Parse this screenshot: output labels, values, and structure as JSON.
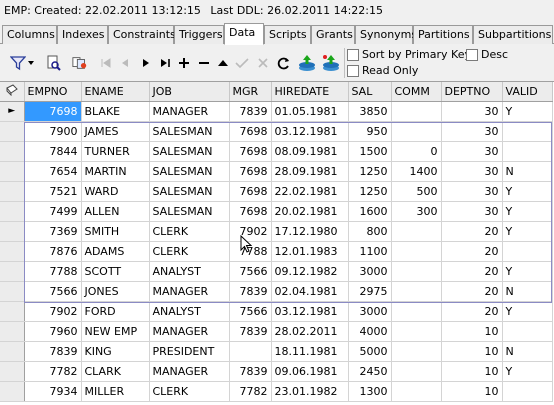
{
  "header": {
    "table_name": "EMP:",
    "created_label": "Created:",
    "created_value": "22.02.2011 13:12:15",
    "ddl_label": "Last DDL:",
    "ddl_value": "26.02.2011 14:22:15"
  },
  "tabs": [
    {
      "label": "Columns"
    },
    {
      "label": "Indexes"
    },
    {
      "label": "Constraints"
    },
    {
      "label": "Triggers"
    },
    {
      "label": "Data"
    },
    {
      "label": "Scripts"
    },
    {
      "label": "Grants"
    },
    {
      "label": "Synonyms"
    },
    {
      "label": "Partitions"
    },
    {
      "label": "Subpartitions"
    }
  ],
  "active_tab": "Data",
  "toolbar": {
    "sort_by_pk_label": "Sort by Primary Key",
    "desc_label": "Desc",
    "read_only_label": "Read Only",
    "icons": [
      "filter-icon",
      "filter-dropdown-icon",
      "find-icon",
      "refresh-icon",
      "first-record-icon",
      "prior-record-icon",
      "next-record-icon",
      "last-record-icon",
      "insert-record-icon",
      "delete-record-icon",
      "edit-record-icon",
      "post-edit-icon",
      "cancel-edit-icon",
      "refresh-data-icon",
      "commit-icon",
      "rollback-icon"
    ]
  },
  "grid": {
    "columns": [
      "EMPNO",
      "ENAME",
      "JOB",
      "MGR",
      "HIREDATE",
      "SAL",
      "COMM",
      "DEPTNO",
      "VALID"
    ],
    "rows": [
      [
        "7698",
        "BLAKE",
        "MANAGER",
        "7839",
        "01.05.1981",
        "3850",
        "",
        "30",
        "Y"
      ],
      [
        "7900",
        "JAMES",
        "SALESMAN",
        "7698",
        "03.12.1981",
        "950",
        "",
        "30",
        ""
      ],
      [
        "7844",
        "TURNER",
        "SALESMAN",
        "7698",
        "08.09.1981",
        "1500",
        "0",
        "30",
        ""
      ],
      [
        "7654",
        "MARTIN",
        "SALESMAN",
        "7698",
        "28.09.1981",
        "1250",
        "1400",
        "30",
        "N"
      ],
      [
        "7521",
        "WARD",
        "SALESMAN",
        "7698",
        "22.02.1981",
        "1250",
        "500",
        "30",
        "Y"
      ],
      [
        "7499",
        "ALLEN",
        "SALESMAN",
        "7698",
        "20.02.1981",
        "1600",
        "300",
        "30",
        "Y"
      ],
      [
        "7369",
        "SMITH",
        "CLERK",
        "7902",
        "17.12.1980",
        "800",
        "",
        "20",
        "Y"
      ],
      [
        "7876",
        "ADAMS",
        "CLERK",
        "7788",
        "12.01.1983",
        "1100",
        "",
        "20",
        ""
      ],
      [
        "7788",
        "SCOTT",
        "ANALYST",
        "7566",
        "09.12.1982",
        "3000",
        "",
        "20",
        "Y"
      ],
      [
        "7566",
        "JONES",
        "MANAGER",
        "7839",
        "02.04.1981",
        "2975",
        "",
        "20",
        "N"
      ],
      [
        "7902",
        "FORD",
        "ANALYST",
        "7566",
        "03.12.1981",
        "3000",
        "",
        "20",
        "Y"
      ],
      [
        "7960",
        "NEW EMP",
        "MANAGER",
        "7839",
        "28.02.2011",
        "4000",
        "",
        "10",
        ""
      ],
      [
        "7839",
        "KING",
        "PRESIDENT",
        "",
        "18.11.1981",
        "5000",
        "",
        "10",
        "N"
      ],
      [
        "7782",
        "CLARK",
        "MANAGER",
        "7839",
        "09.06.1981",
        "2450",
        "",
        "10",
        "Y"
      ],
      [
        "7934",
        "MILLER",
        "CLERK",
        "7782",
        "23.01.1982",
        "1300",
        "",
        "10",
        ""
      ]
    ],
    "current_row_marker": "►",
    "colors": {
      "selected_cell": "#3399ff",
      "selection_frame": "#8b8bc4"
    }
  }
}
